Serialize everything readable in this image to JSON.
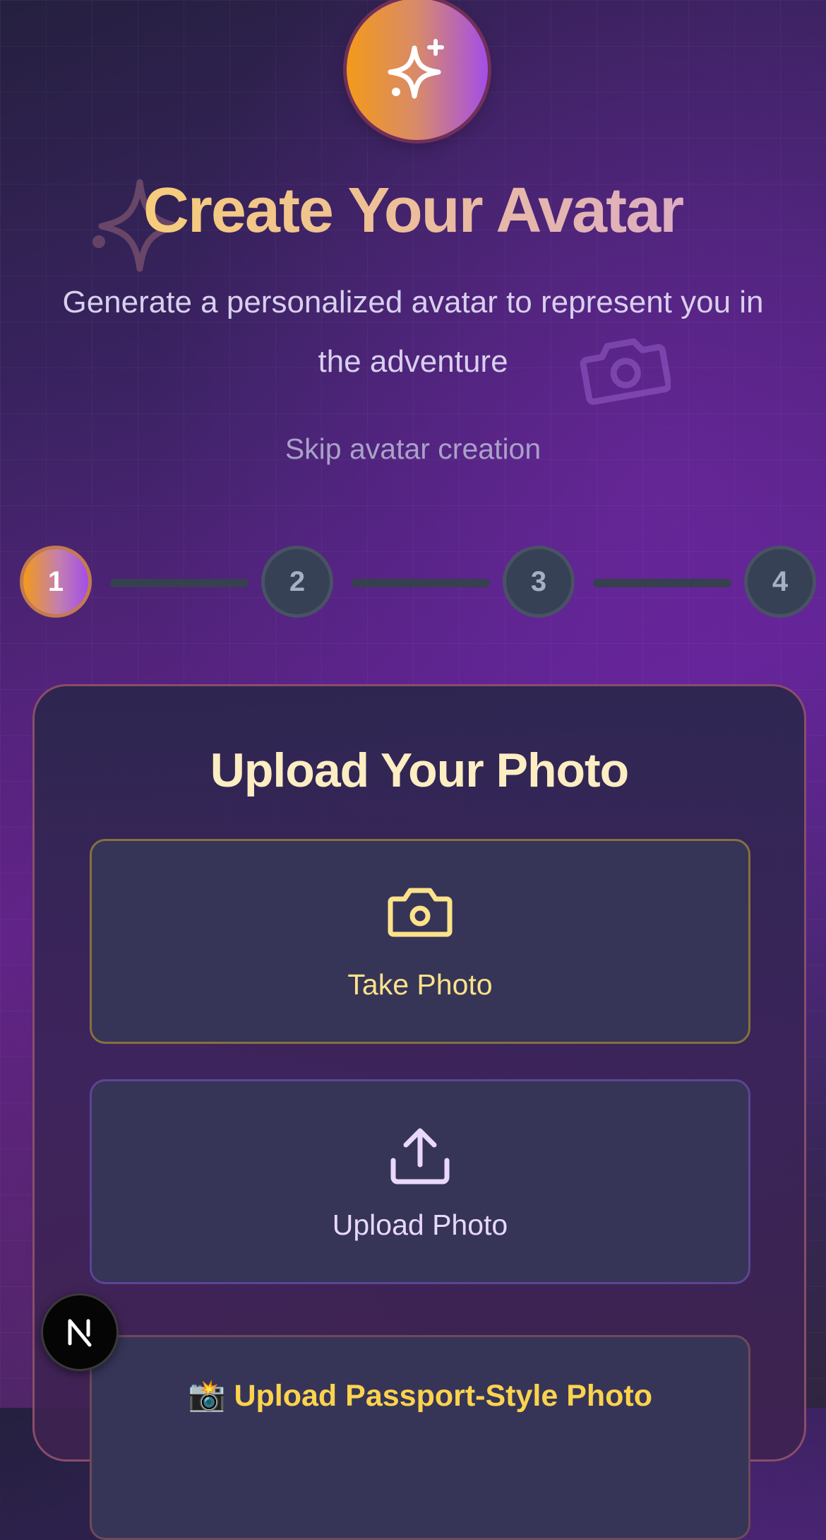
{
  "header": {
    "title": "Create Your Avatar",
    "subtitle": "Generate a personalized avatar to represent you in the adventure",
    "skip_label": "Skip avatar creation",
    "badge_icon": "sparkles-icon"
  },
  "stepper": {
    "steps": [
      "1",
      "2",
      "3",
      "4"
    ],
    "active_step": 1
  },
  "card": {
    "title": "Upload Your Photo",
    "options": [
      {
        "label": "Take Photo",
        "icon": "camera-icon"
      },
      {
        "label": "Upload Photo",
        "icon": "upload-icon"
      },
      {
        "label": "📸 Upload Passport-Style Photo",
        "icon": "camera-flash-emoji"
      }
    ]
  },
  "dev_badge": {
    "label": "N"
  },
  "colors": {
    "accent_orange": "#f39a1a",
    "accent_purple": "#a34ee8",
    "title_gold": "#fcd56a",
    "camera_label": "#fde28a",
    "upload_label": "#e9d8fb",
    "passport_label": "#fcd34d",
    "step_inactive": "#374155"
  }
}
